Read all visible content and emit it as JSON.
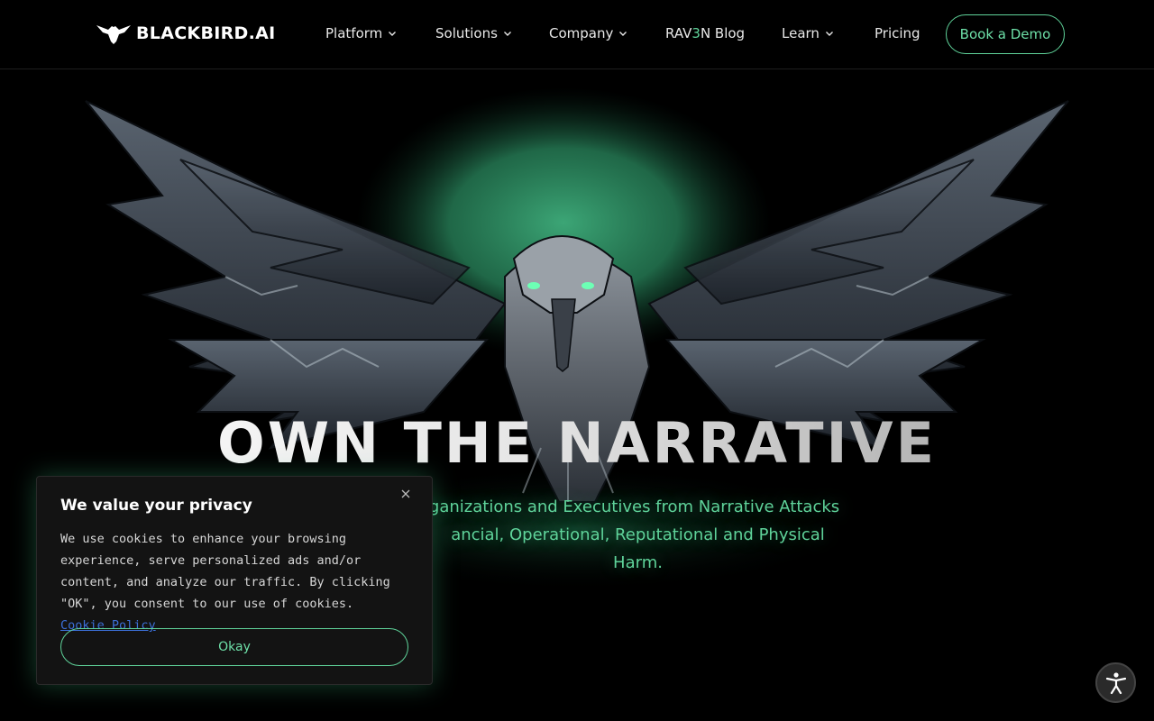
{
  "brand": {
    "logo_text": "BLACKBIRD.AI"
  },
  "nav": {
    "platform": "Platform",
    "solutions": "Solutions",
    "company": "Company",
    "blog_prefix": "RAV",
    "blog_three": "3",
    "blog_suffix": "N Blog",
    "learn": "Learn",
    "pricing": "Pricing",
    "demo": "Book a Demo"
  },
  "hero": {
    "title": "OWN THE NARRATIVE",
    "subtitle_line1": "rganizations and Executives from Narrative Attacks",
    "subtitle_line2": "ancial, Operational, Reputational and Physical Harm."
  },
  "cookie": {
    "title": "We value your privacy",
    "body": "We use cookies to enhance your browsing experience, serve personalized ads and/or content, and analyze our traffic. By clicking \"OK\", you consent to our use of cookies.",
    "link": "Cookie Policy",
    "button": "Okay"
  },
  "colors": {
    "accent": "#5fd39a",
    "background": "#000000",
    "link": "#3b6fd8"
  },
  "icons": {
    "logo": "blackbird-logo-icon",
    "chevron": "chevron-down-icon",
    "close": "close-icon",
    "accessibility": "accessibility-icon"
  }
}
